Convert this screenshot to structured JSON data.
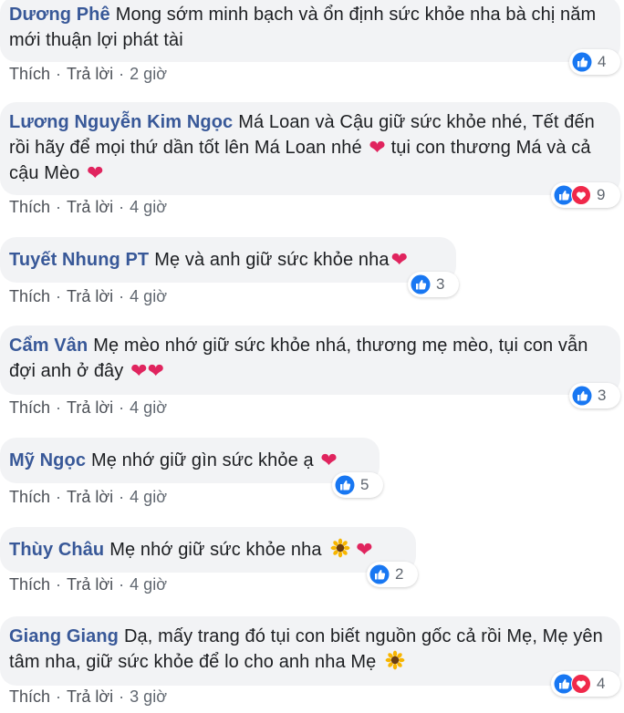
{
  "colors": {
    "author": "#385898",
    "bubble": "#f2f3f5",
    "meta": "#606770",
    "like": "#1877f2",
    "love": "#e0245e"
  },
  "comments": [
    {
      "author": "Dương Phê",
      "text": "Mong sớm minh bạch và ổn định sức khỏe nha bà chị năm mới thuận lợi phát tài",
      "like_label": "Thích",
      "reply_label": "Trả lời",
      "time": "2 giờ",
      "reactions": [
        "like-icon"
      ],
      "reaction_count": "4"
    },
    {
      "author": "Lương Nguyễn Kim Ngọc",
      "text": "Má Loan và Cậu giữ sức khỏe nhé, Tết đến rồi hãy để mọi thứ dần tốt lên Má Loan nhé",
      "text_2": "tụi con thương Má và cả cậu Mèo",
      "like_label": "Thích",
      "reply_label": "Trả lời",
      "time": "4 giờ",
      "reactions": [
        "like-icon",
        "love-icon"
      ],
      "reaction_count": "9"
    },
    {
      "author": "Tuyết Nhung PT",
      "text": "Mẹ và anh giữ sức khỏe nha",
      "like_label": "Thích",
      "reply_label": "Trả lời",
      "time": "4 giờ",
      "reactions": [
        "like-icon"
      ],
      "reaction_count": "3"
    },
    {
      "author": "Cẩm Vân",
      "text": "Mẹ mèo nhớ giữ sức khỏe nhá, thương mẹ mèo, tụi con vẫn đợi anh ở đây",
      "like_label": "Thích",
      "reply_label": "Trả lời",
      "time": "4 giờ",
      "reactions": [
        "like-icon"
      ],
      "reaction_count": "3"
    },
    {
      "author": "Mỹ Ngọc",
      "text": "Mẹ nhớ giữ gìn sức khỏe ạ",
      "like_label": "Thích",
      "reply_label": "Trả lời",
      "time": "4 giờ",
      "reactions": [
        "like-icon"
      ],
      "reaction_count": "5"
    },
    {
      "author": "Thùy Châu",
      "text": "Mẹ nhớ giữ sức khỏe nha",
      "like_label": "Thích",
      "reply_label": "Trả lời",
      "time": "4 giờ",
      "reactions": [
        "like-icon"
      ],
      "reaction_count": "2"
    },
    {
      "author": "Giang Giang",
      "text": "Dạ, mấy trang đó tụi con biết nguồn gốc cả rồi Mẹ, Mẹ yên tâm nha, giữ sức khỏe để lo cho anh nha Mẹ",
      "like_label": "Thích",
      "reply_label": "Trả lời",
      "time": "3 giờ",
      "reactions": [
        "like-icon",
        "love-icon"
      ],
      "reaction_count": "4"
    }
  ]
}
